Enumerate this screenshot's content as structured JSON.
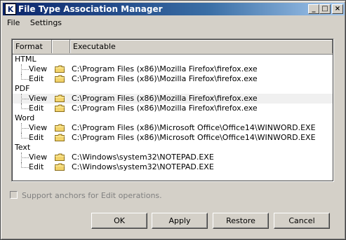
{
  "window": {
    "title": "File Type Association Manager",
    "controls": {
      "minimize": "_",
      "maximize": "□",
      "close": "×"
    }
  },
  "menu": [
    "File",
    "Settings"
  ],
  "table": {
    "columns": [
      "Format",
      "",
      "Executable"
    ],
    "groups": [
      {
        "format": "HTML",
        "rows": [
          {
            "action": "View",
            "path": "C:\\Program Files (x86)\\Mozilla Firefox\\firefox.exe"
          },
          {
            "action": "Edit",
            "path": "C:\\Program Files (x86)\\Mozilla Firefox\\firefox.exe"
          }
        ]
      },
      {
        "format": "PDF",
        "rows": [
          {
            "action": "View",
            "path": "C:\\Program Files (x86)\\Mozilla Firefox\\firefox.exe"
          },
          {
            "action": "Edit",
            "path": "C:\\Program Files (x86)\\Mozilla Firefox\\firefox.exe"
          }
        ]
      },
      {
        "format": "Word",
        "rows": [
          {
            "action": "View",
            "path": "C:\\Program Files (x86)\\Microsoft Office\\Office14\\WINWORD.EXE"
          },
          {
            "action": "Edit",
            "path": "C:\\Program Files (x86)\\Microsoft Office\\Office14\\WINWORD.EXE"
          }
        ]
      },
      {
        "format": "Text",
        "rows": [
          {
            "action": "View",
            "path": "C:\\Windows\\system32\\NOTEPAD.EXE"
          },
          {
            "action": "Edit",
            "path": "C:\\Windows\\system32\\NOTEPAD.EXE"
          }
        ]
      }
    ]
  },
  "options": {
    "support_anchors_label": "Support anchors for Edit operations.",
    "support_anchors_checked": false
  },
  "buttons": {
    "ok": "OK",
    "apply": "Apply",
    "restore": "Restore",
    "cancel": "Cancel"
  },
  "icons": {
    "folder": "folder-icon",
    "app": "app-icon"
  },
  "colors": {
    "titlebar_start": "#0a246a",
    "titlebar_end": "#a6caf0",
    "folder": "#f2d36b"
  }
}
